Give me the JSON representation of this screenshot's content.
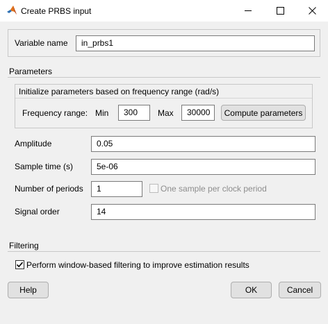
{
  "window": {
    "title": "Create PRBS input",
    "minimize_icon": "minimize-icon",
    "maximize_icon": "maximize-icon",
    "close_icon": "close-icon",
    "app_icon": "matlab-icon"
  },
  "variable": {
    "label": "Variable name",
    "value": "in_prbs1"
  },
  "parameters": {
    "section_label": "Parameters",
    "group_title": "Initialize parameters based on frequency range (rad/s)",
    "frequency_range_label": "Frequency range:",
    "min_label": "Min",
    "min_value": "300",
    "max_label": "Max",
    "max_value": "30000",
    "compute_button": "Compute parameters",
    "amplitude_label": "Amplitude",
    "amplitude_value": "0.05",
    "sample_time_label": "Sample time (s)",
    "sample_time_value": "5e-06",
    "num_periods_label": "Number of periods",
    "num_periods_value": "1",
    "one_sample_label": "One sample per clock period",
    "one_sample_checked": false,
    "signal_order_label": "Signal order",
    "signal_order_value": "14"
  },
  "filtering": {
    "section_label": "Filtering",
    "checkbox_label": "Perform window-based filtering to improve estimation results",
    "checked": true
  },
  "buttons": {
    "help": "Help",
    "ok": "OK",
    "cancel": "Cancel"
  }
}
